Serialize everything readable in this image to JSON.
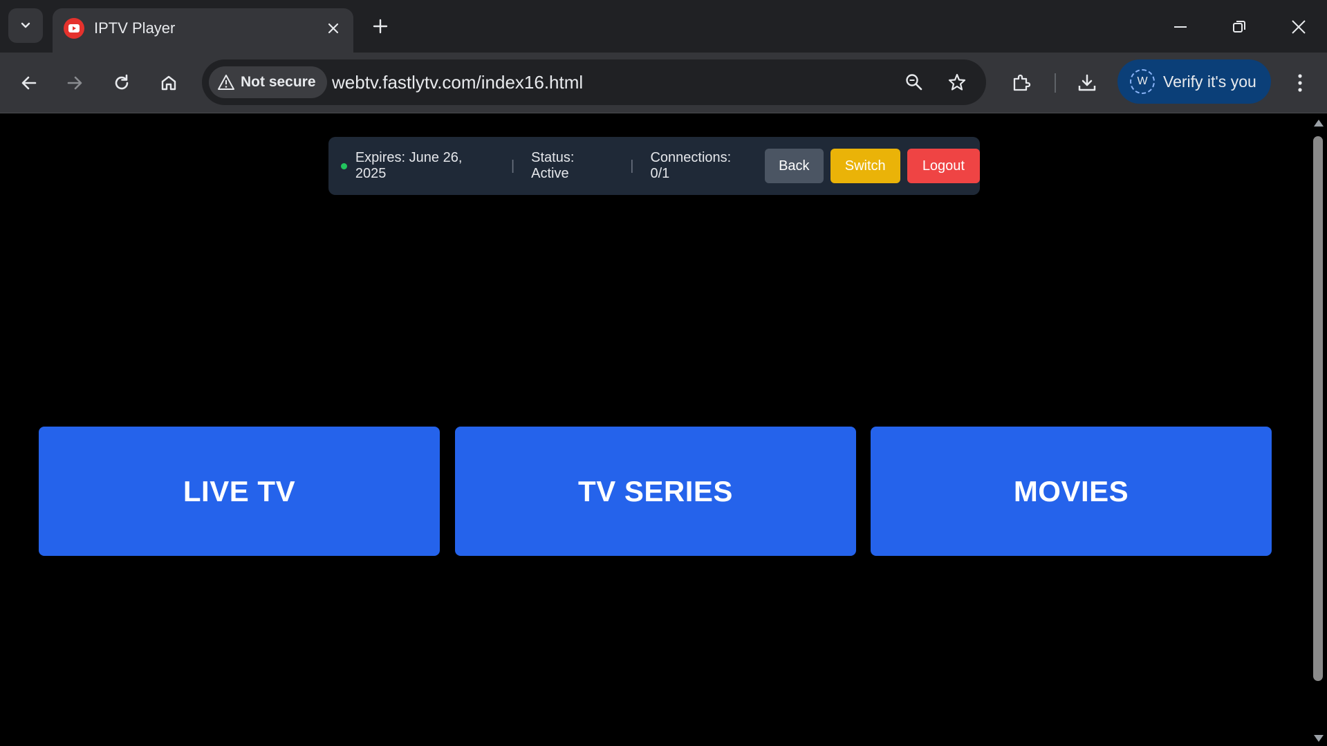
{
  "browser": {
    "tab": {
      "title": "IPTV Player"
    },
    "address": {
      "security_label": "Not secure",
      "url": "webtv.fastlytv.com/index16.html"
    },
    "profile": {
      "avatar_letter": "W",
      "verify_label": "Verify it's you"
    }
  },
  "account_bar": {
    "status_dot_color": "#22c55e",
    "expires": "Expires: June 26, 2025",
    "separator": "|",
    "status": "Status: Active",
    "connections": "Connections: 0/1",
    "back_label": "Back",
    "switch_label": "Switch",
    "logout_label": "Logout"
  },
  "categories": [
    {
      "label": "LIVE TV"
    },
    {
      "label": "TV SERIES"
    },
    {
      "label": "MOVIES"
    }
  ],
  "colors": {
    "tile": "#2563eb",
    "back": "#4b5563",
    "switch": "#eab308",
    "logout": "#ef4444"
  }
}
